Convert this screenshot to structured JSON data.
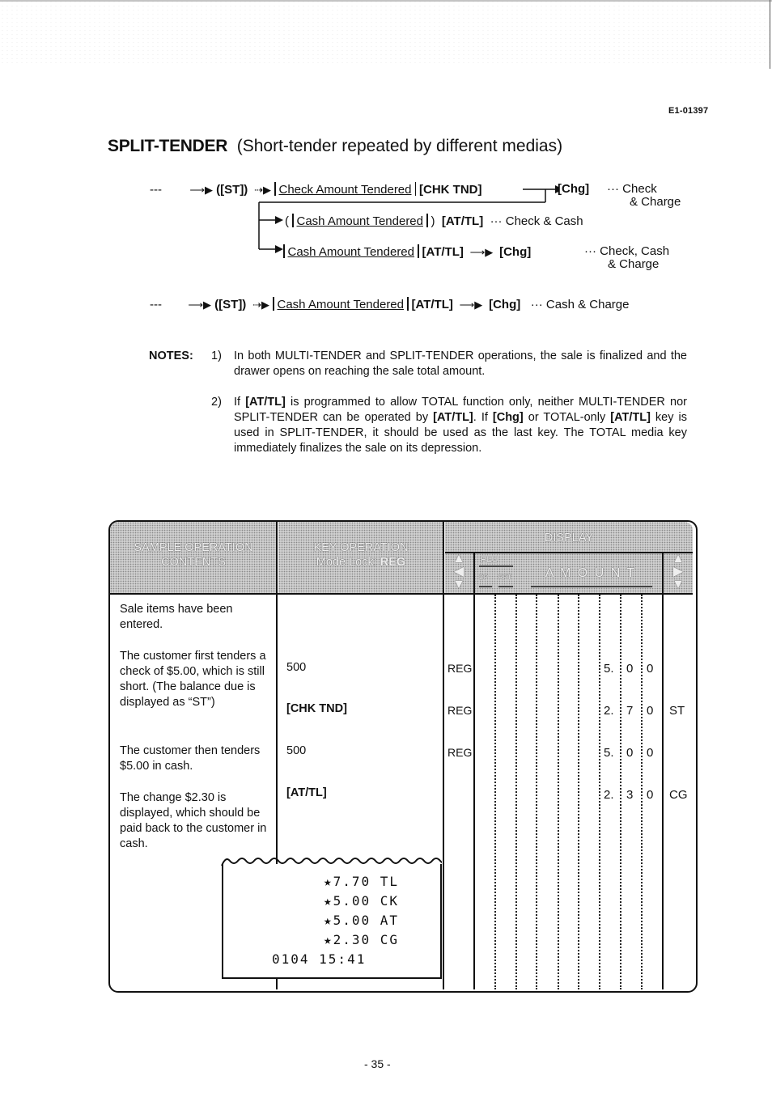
{
  "document_id": "E1-01397",
  "title": {
    "main": "SPLIT-TENDER",
    "subtitle": "(Short-tender repeated by different medias)"
  },
  "flow_1": {
    "lead": "---",
    "st": "([ST])",
    "check_amount": "Check Amount Tendered",
    "chk_tnd": "[CHK TND]",
    "chg": "[Chg]",
    "result": "Check",
    "result_2": "& Charge",
    "branch_a": {
      "open_paren": "(",
      "cash_amount": "Cash Amount Tendered",
      "close_paren": ")",
      "key": "[AT/TL]",
      "result": "Check & Cash"
    },
    "branch_b": {
      "cash_amount": "Cash Amount Tendered",
      "key": "[AT/TL]",
      "chg": "[Chg]",
      "result": "Check, Cash",
      "result_2": "& Charge"
    }
  },
  "flow_2": {
    "lead": "---",
    "st": "([ST])",
    "cash_amount": "Cash Amount Tendered",
    "key": "[AT/TL]",
    "chg": "[Chg]",
    "result": "Cash & Charge"
  },
  "ellipsis": "···",
  "notes": {
    "label": "NOTES:",
    "items": [
      {
        "num": "1)",
        "text": "In both MULTI-TENDER and SPLIT-TENDER operations, the sale is finalized and the drawer opens on reaching the sale total amount."
      },
      {
        "num": "2)",
        "parts": [
          "If ",
          "[AT/TL]",
          " is programmed to allow TOTAL function only, neither MULTI-TENDER nor SPLIT-TENDER can be operated by ",
          "[AT/TL]",
          ".   If ",
          "[Chg]",
          " or TOTAL-only ",
          "[AT/TL]",
          " key is used in SPLIT-TENDER, it should be used as the last key.   The TOTAL media key immediately finalizes the sale on its depression."
        ]
      }
    ]
  },
  "table": {
    "headers": {
      "contents_1": "SAMPLE OPERATION",
      "contents_2": "CONTENTS",
      "key_1": "KEY OPERATION",
      "key_2": "Mode Lock:",
      "key_mode": "REG",
      "display": "DISPLAY",
      "plu": "PLU",
      "dp": "DP",
      "rpt": "RPT",
      "amount": "A M O U N T"
    },
    "contents": [
      "Sale items have been entered.",
      "The customer first tenders a check of $5.00, which is still short.  (The balance due is displayed as “ST”)",
      "The customer then tenders $5.00 in cash.",
      "The change $2.30 is displayed, which should be paid back to the customer in cash."
    ],
    "rows": [
      {
        "key": "500",
        "mode": "REG",
        "digits": [
          "5.",
          "0",
          "0"
        ],
        "suffix": ""
      },
      {
        "key": "[CHK TND]",
        "mode": "REG",
        "digits": [
          "2.",
          "7",
          "0"
        ],
        "suffix": "ST"
      },
      {
        "key": "500",
        "mode": "REG",
        "digits": [
          "5.",
          "0",
          "0"
        ],
        "suffix": ""
      },
      {
        "key": "[AT/TL]",
        "mode": "",
        "digits": [
          "2.",
          "3",
          "0"
        ],
        "suffix": "CG"
      }
    ],
    "receipt": [
      "★7.70  TL",
      "★5.00  CK",
      "★5.00  AT",
      "★2.30  CG",
      "0104  15:41"
    ]
  },
  "page_number": "- 35 -"
}
